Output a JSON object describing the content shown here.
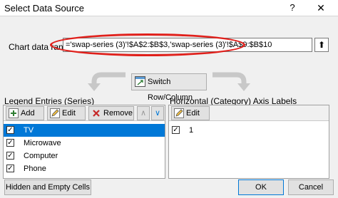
{
  "window": {
    "title": "Select Data Source",
    "help_label": "?",
    "close_label": "✕"
  },
  "range": {
    "label": "Chart data range:",
    "value": "='swap-series (3)'!$A$2:$B$3,'swap-series (3)'!$A$9:$B$10",
    "collapse_glyph": "⬆"
  },
  "switch_button": {
    "label": "Switch Row/Column"
  },
  "legend": {
    "title": "Legend Entries (Series)",
    "toolbar": {
      "add_label": "Add",
      "edit_label": "Edit",
      "remove_label": "Remove",
      "up_glyph": "∧",
      "down_glyph": "∨"
    },
    "items": [
      {
        "label": "TV",
        "checked": "✓",
        "selected": true
      },
      {
        "label": "Microwave",
        "checked": "✓",
        "selected": false
      },
      {
        "label": "Computer",
        "checked": "✓",
        "selected": false
      },
      {
        "label": "Phone",
        "checked": "✓",
        "selected": false
      }
    ]
  },
  "axis": {
    "title": "Horizontal (Category) Axis Labels",
    "toolbar": {
      "edit_label": "Edit"
    },
    "items": [
      {
        "label": "1",
        "checked": "✓"
      }
    ]
  },
  "footer": {
    "hidden_cells_label": "Hidden and Empty Cells",
    "ok_label": "OK",
    "cancel_label": "Cancel"
  },
  "colors": {
    "selection": "#0078d7",
    "highlight_oval": "#e0201b",
    "add_icon": "#2e7d32",
    "remove_icon": "#c62828"
  }
}
